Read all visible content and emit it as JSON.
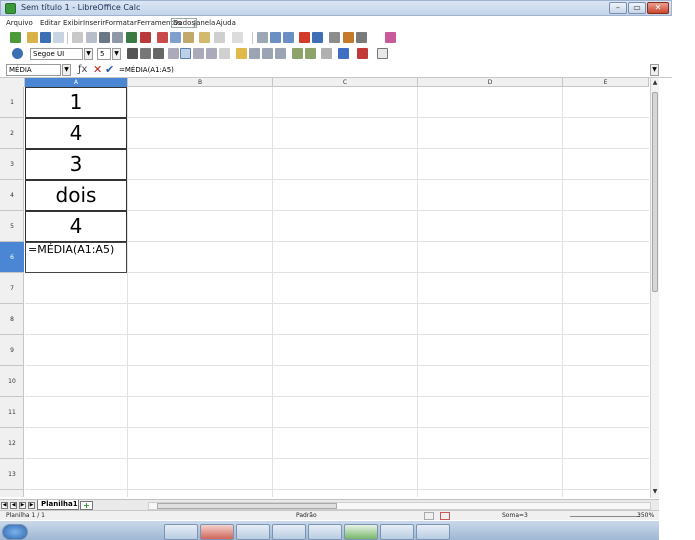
{
  "window": {
    "title": "Sem título 1 - LibreOffice Calc",
    "minimize": "–",
    "maximize": "▭",
    "close": "✕"
  },
  "menu": [
    "Arquivo",
    "Editar",
    "Exibir",
    "Inserir",
    "Formatar",
    "Ferramentas",
    "Dados",
    "Janela",
    "Ajuda"
  ],
  "format_toolbar": {
    "font_name": "Segoe UI",
    "font_size": "5"
  },
  "formula_bar": {
    "name_box": "MÉDIA",
    "content": "=MÉDIA(A1:A5)"
  },
  "columns": [
    "A",
    "B",
    "C",
    "D",
    "E"
  ],
  "rows": [
    "1",
    "2",
    "3",
    "4",
    "5",
    "6",
    "7",
    "8",
    "9",
    "10",
    "11",
    "12",
    "13"
  ],
  "cells": [
    "1",
    "4",
    "3",
    "dois",
    "4",
    "=MÉDIA(A1:A5)"
  ],
  "sheet_tab": "Planilha1",
  "status": {
    "sheet": "Planilha 1 / 1",
    "style": "Padrão",
    "sum": "Soma=3",
    "zoom": "350%"
  },
  "colors": {
    "accent": "#3c6fb4",
    "selected_row_header": "#4a86d4"
  }
}
